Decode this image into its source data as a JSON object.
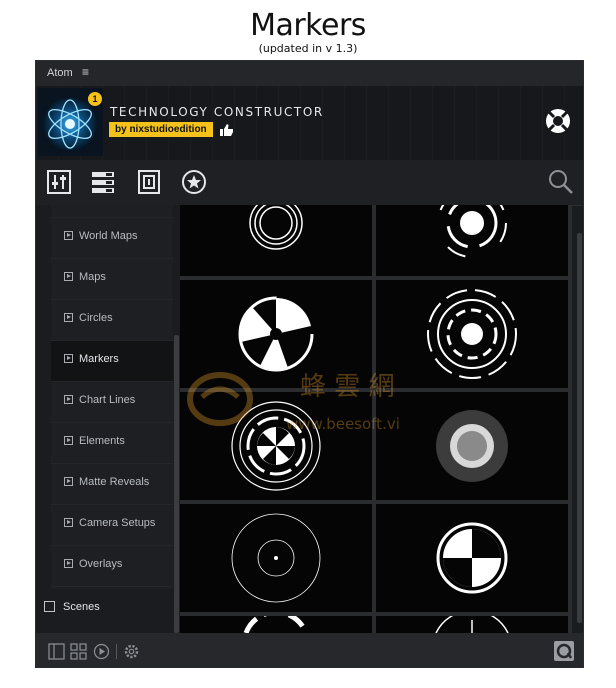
{
  "page": {
    "title": "Markers",
    "subtitle": "(updated in v 1.3)"
  },
  "menubar": {
    "label": "Atom",
    "menu_icon": "hamburger-icon"
  },
  "header": {
    "badge_count": "1",
    "title": "TECHNOLOGY CONSTRUCTOR",
    "byline": "by nixstudioedition",
    "like_icon": "thumbs-up-icon",
    "help_icon": "lifebuoy-icon"
  },
  "toolbar": {
    "icons": [
      "sliders-icon",
      "list-icon",
      "film-icon",
      "star-icon"
    ],
    "search_icon": "search-icon"
  },
  "sidebar": {
    "items": [
      {
        "label": "World Maps"
      },
      {
        "label": "Maps"
      },
      {
        "label": "Circles"
      },
      {
        "label": "Markers",
        "active": true
      },
      {
        "label": "Chart Lines"
      },
      {
        "label": "Elements"
      },
      {
        "label": "Matte Reveals"
      },
      {
        "label": "Camera Setups"
      },
      {
        "label": "Overlays"
      }
    ],
    "scenes_label": "Scenes"
  },
  "grid": {
    "thumbnails": [
      "concentric-rings-marker",
      "dashed-ring-dot-marker",
      "pie-segment-marker",
      "dashed-target-marker",
      "fan-blade-marker",
      "grey-dot-marker",
      "thin-ring-dot-marker",
      "quadrant-ring-marker",
      "partial-arc-marker",
      "crosshair-arc-marker"
    ]
  },
  "footer": {
    "icons": [
      "panel-icon",
      "grid-icon",
      "play-icon",
      "settings-icon"
    ],
    "right_icon": "atom-logo-icon"
  },
  "watermark": {
    "text": "www.beesoft.vi",
    "cjk": "蜂 雲 網"
  },
  "colors": {
    "accent": "#f4c21b",
    "panel": "#1a1c1f",
    "cell": "#050505"
  }
}
